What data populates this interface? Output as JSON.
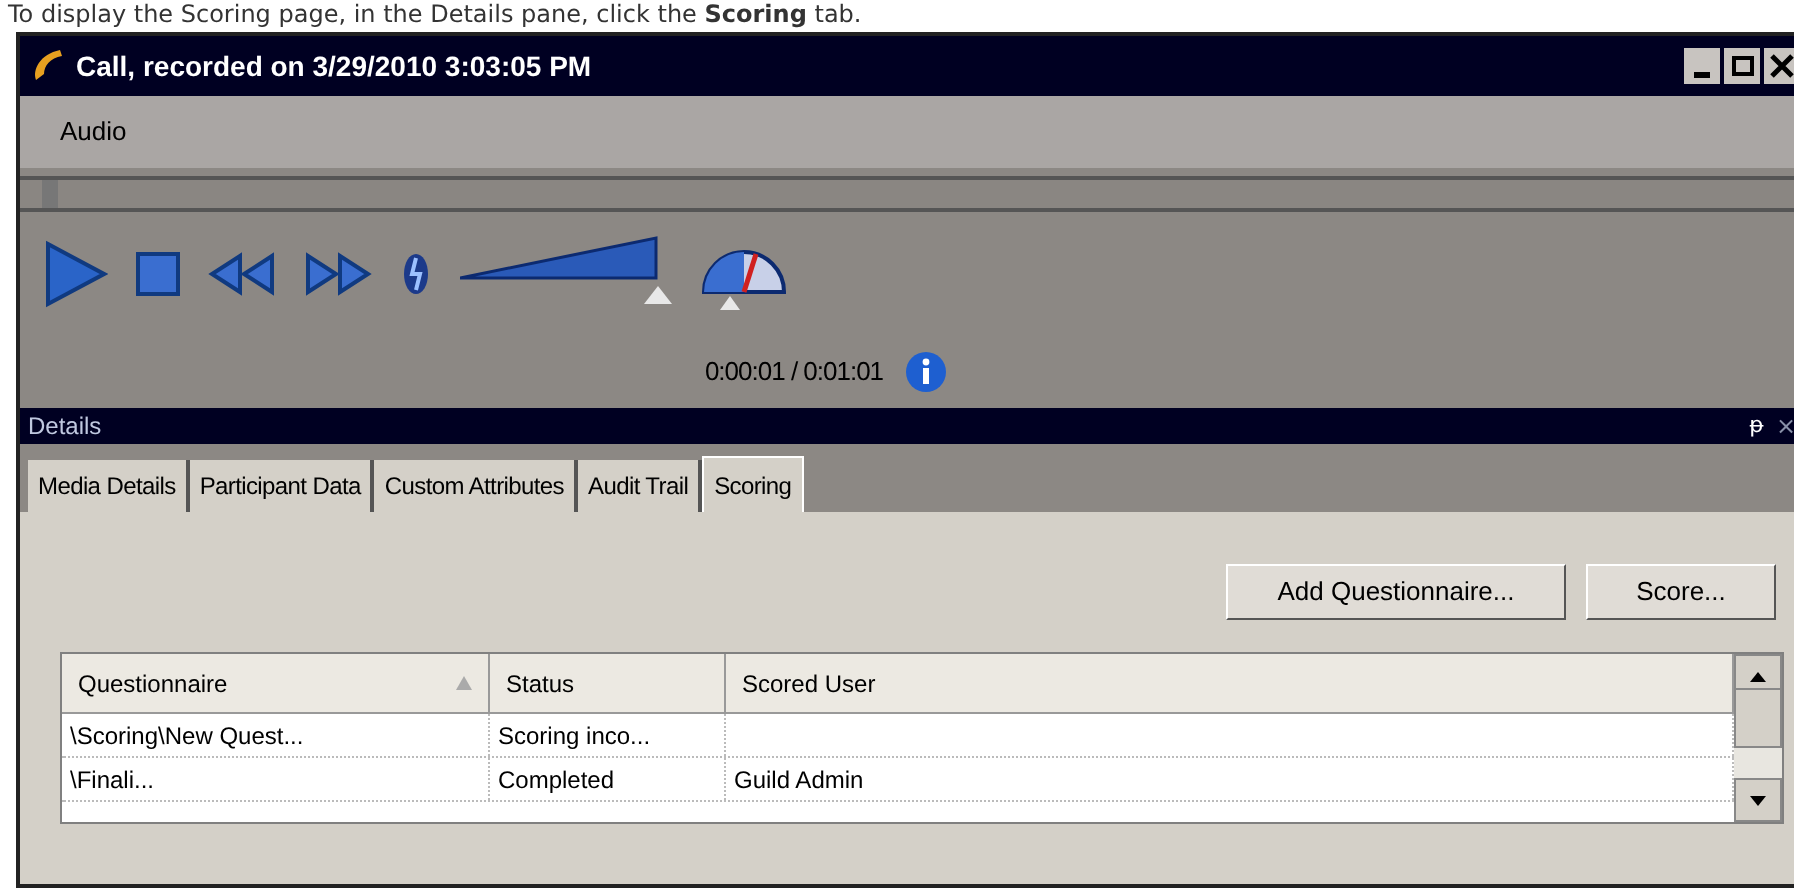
{
  "instruction": "To display the Scoring page, in the Details pane, click the **Scoring** tab.",
  "window": {
    "title": "Call,  recorded on 3/29/2010 3:03:05 PM"
  },
  "menu": [
    {
      "label": "Audio"
    }
  ],
  "player": {
    "seek": {
      "level": 0.03
    },
    "volume": {
      "level": 1.0
    },
    "time": "0:00:01 / 0:01:01"
  },
  "details": {
    "title": "Details",
    "pin": "ᵽ",
    "close": "×"
  },
  "tabs": [
    {
      "label": "Media Details",
      "selected": false
    },
    {
      "label": "Participant Data",
      "selected": false
    },
    {
      "label": "Custom Attributes",
      "selected": false
    },
    {
      "label": "Audit Trail",
      "selected": false
    },
    {
      "label": "Scoring",
      "selected": true
    }
  ],
  "buttons": [
    "Add Questionnaire...",
    "Score..."
  ],
  "table": {
    "columns": [
      "Questionnaire",
      "Status",
      "Scored User"
    ],
    "rows": [
      [
        "\\Scoring\\New  Quest...",
        "Scoring  inco...",
        ""
      ],
      [
        "\\Finali...",
        "Completed",
        "Guild Admin"
      ]
    ]
  }
}
